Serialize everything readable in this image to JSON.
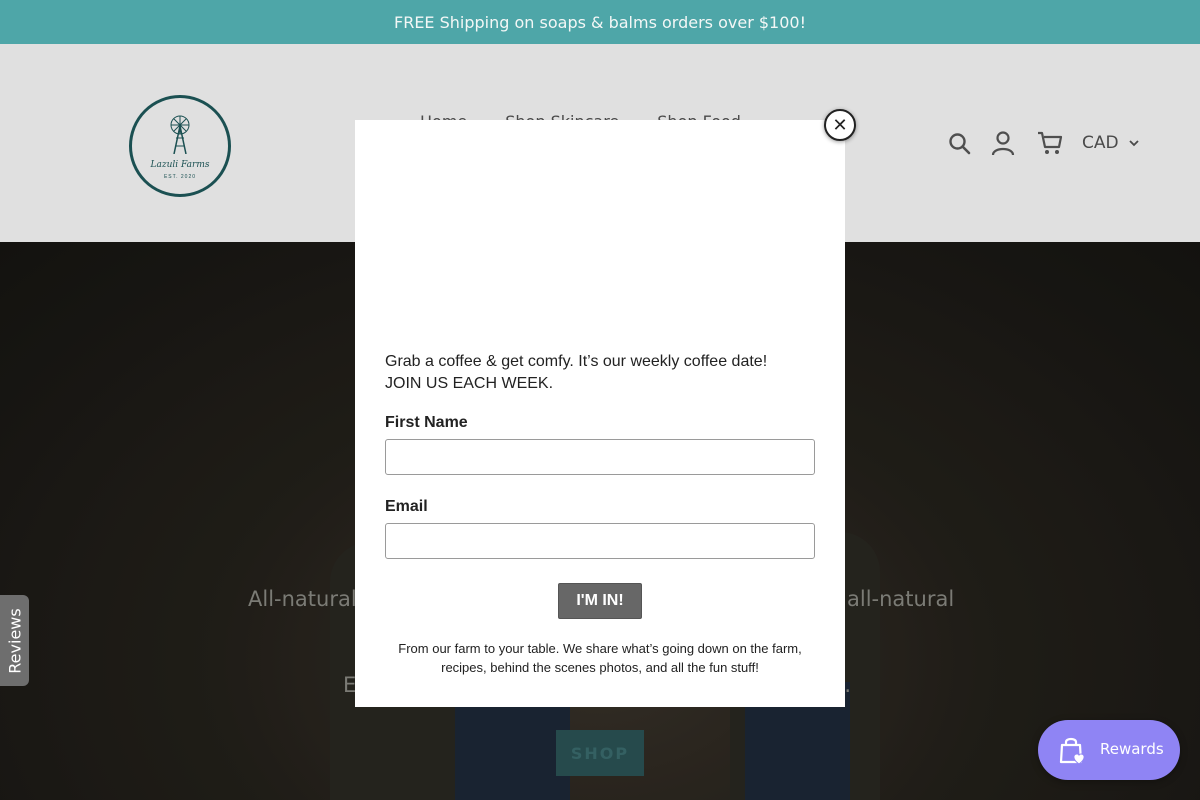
{
  "announcement": {
    "text": "FREE Shipping on soaps & balms orders over $100!"
  },
  "header": {
    "logo": {
      "brand": "Lazuli Farms",
      "est": "EST. 2020"
    },
    "nav": [
      "Home",
      "Shop Skincare",
      "Shop Food"
    ],
    "currency": "CAD"
  },
  "hero": {
    "line1_left": "All-natural",
    "line1_right": "all-natural",
    "line2_left": "E",
    "line2_right": "d.",
    "shop_label": "SHOP"
  },
  "modal": {
    "intro_line1": "Grab a coffee & get comfy. It’s our weekly coffee date!",
    "intro_line2": "JOIN US EACH WEEK.",
    "first_name_label": "First Name",
    "email_label": "Email",
    "submit_label": "I'M IN!",
    "footer_text": "From our farm to your table. We share what’s going down on the farm, recipes, behind the scenes photos, and all the fun stuff!",
    "close_label": "✕"
  },
  "reviews_tab": {
    "label": "Reviews"
  },
  "rewards": {
    "label": "Rewards"
  },
  "colors": {
    "announcement_bg": "#4ea6a8",
    "brand_teal": "#1f5c5e",
    "rewards_bg": "#8f84f4"
  }
}
